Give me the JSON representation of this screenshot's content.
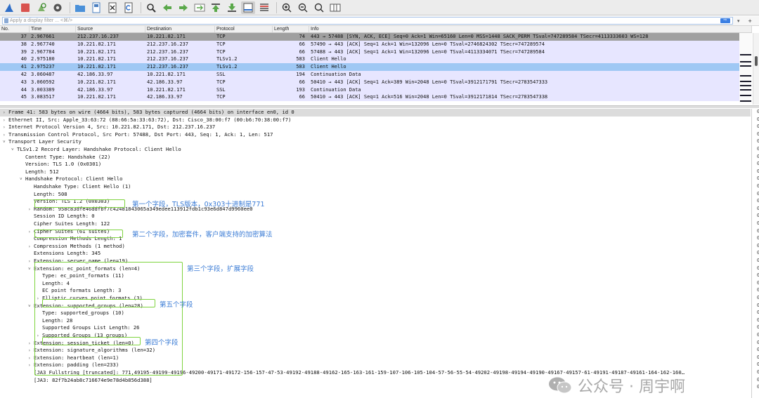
{
  "toolbar": {
    "icons": [
      "shark-fin-icon",
      "stop-icon",
      "restart-icon",
      "options-gear-icon",
      "open-folder-icon",
      "save-file-icon",
      "close-file-icon",
      "reload-icon",
      "find-icon",
      "go-back-icon",
      "go-forward-icon",
      "go-to-packet-icon",
      "first-packet-icon",
      "last-packet-icon",
      "autoscroll-icon",
      "colorize-icon",
      "zoom-in-icon",
      "zoom-out-icon",
      "normal-size-icon",
      "resize-columns-icon"
    ]
  },
  "filter": {
    "placeholder": "Apply a display filter ... <⌘/>",
    "apply_arrow": "⇨",
    "dropdown": "▾",
    "plus": "+"
  },
  "packet_list": {
    "columns": [
      "No.",
      "Time",
      "Source",
      "Destination",
      "Protocol",
      "Length",
      "Info"
    ],
    "rows": [
      {
        "no": "37",
        "time": "2.967661",
        "src": "212.237.16.237",
        "dst": "10.221.82.171",
        "proto": "TCP",
        "len": "74",
        "info": "443 → 57488 [SYN, ACK, ECE] Seq=0 Ack=1 Win=65160 Len=0 MSS=1448 SACK_PERM TSval=747289584 TSecr=4113333603 WS=128",
        "style": "syn"
      },
      {
        "no": "38",
        "time": "2.967740",
        "src": "10.221.82.171",
        "dst": "212.237.16.237",
        "proto": "TCP",
        "len": "66",
        "info": "57490 → 443 [ACK] Seq=1 Ack=1 Win=132096 Len=0 TSval=2746824302 TSecr=747289574",
        "style": "tcp"
      },
      {
        "no": "39",
        "time": "2.967784",
        "src": "10.221.82.171",
        "dst": "212.237.16.237",
        "proto": "TCP",
        "len": "66",
        "info": "57488 → 443 [ACK] Seq=1 Ack=1 Win=132096 Len=0 TSval=4113334071 TSecr=747289584",
        "style": "tcp"
      },
      {
        "no": "40",
        "time": "2.975180",
        "src": "10.221.82.171",
        "dst": "212.237.16.237",
        "proto": "TLSv1.2",
        "len": "583",
        "info": "Client Hello",
        "style": "tcp"
      },
      {
        "no": "41",
        "time": "2.975237",
        "src": "10.221.82.171",
        "dst": "212.237.16.237",
        "proto": "TLSv1.2",
        "len": "583",
        "info": "Client Hello",
        "style": "sel"
      },
      {
        "no": "42",
        "time": "3.060487",
        "src": "42.186.33.97",
        "dst": "10.221.82.171",
        "proto": "SSL",
        "len": "194",
        "info": "Continuation Data",
        "style": "tcp"
      },
      {
        "no": "43",
        "time": "3.060592",
        "src": "10.221.82.171",
        "dst": "42.186.33.97",
        "proto": "TCP",
        "len": "66",
        "info": "50410 → 443 [ACK] Seq=1 Ack=389 Win=2048 Len=0 TSval=3912171791 TSecr=2783547333",
        "style": "tcp"
      },
      {
        "no": "44",
        "time": "3.003389",
        "src": "42.186.33.97",
        "dst": "10.221.82.171",
        "proto": "SSL",
        "len": "193",
        "info": "Continuation Data",
        "style": "tcp"
      },
      {
        "no": "45",
        "time": "3.083517",
        "src": "10.221.82.171",
        "dst": "42.186.33.97",
        "proto": "TCP",
        "len": "66",
        "info": "50410 → 443 [ACK] Seq=1 Ack=516 Win=2048 Len=0 TSval=3912171814 TSecr=2783547338",
        "style": "tcp"
      }
    ]
  },
  "detail": {
    "lines": [
      {
        "text": "Frame 41: 583 bytes on wire (4664 bits), 583 bytes captured (4664 bits) on interface en0, id 0",
        "indent": 0,
        "arrow": "›",
        "hl": true
      },
      {
        "text": "Ethernet II, Src: Apple_33:63:72 (88:66:5a:33:63:72), Dst: Cisco_38:00:f7 (00:b6:70:38:00:f7)",
        "indent": 0,
        "arrow": "›"
      },
      {
        "text": "Internet Protocol Version 4, Src: 10.221.82.171, Dst: 212.237.16.237",
        "indent": 0,
        "arrow": "›"
      },
      {
        "text": "Transmission Control Protocol, Src Port: 57488, Dst Port: 443, Seq: 1, Ack: 1, Len: 517",
        "indent": 0,
        "arrow": "›"
      },
      {
        "text": "Transport Layer Security",
        "indent": 0,
        "arrow": "˅"
      },
      {
        "text": "TLSv1.2 Record Layer: Handshake Protocol: Client Hello",
        "indent": 1,
        "arrow": "˅"
      },
      {
        "text": "Content Type: Handshake (22)",
        "indent": 2,
        "arrow": ""
      },
      {
        "text": "Version: TLS 1.0 (0x0301)",
        "indent": 2,
        "arrow": ""
      },
      {
        "text": "Length: 512",
        "indent": 2,
        "arrow": ""
      },
      {
        "text": "Handshake Protocol: Client Hello",
        "indent": 2,
        "arrow": "˅"
      },
      {
        "text": "Handshake Type: Client Hello (1)",
        "indent": 3,
        "arrow": ""
      },
      {
        "text": "Length: 508",
        "indent": 3,
        "arrow": ""
      },
      {
        "text": "Version: TLS 1.2 (0x0303)",
        "indent": 3,
        "arrow": ""
      },
      {
        "text": "Random: 958c83dfe46ddfbf7c42481843065a349edee113912fdb1c93e6d847d9960ee0",
        "indent": 3,
        "arrow": "›"
      },
      {
        "text": "Session ID Length: 0",
        "indent": 3,
        "arrow": ""
      },
      {
        "text": "Cipher Suites Length: 122",
        "indent": 3,
        "arrow": ""
      },
      {
        "text": "Cipher Suites (61 suites)",
        "indent": 3,
        "arrow": "›"
      },
      {
        "text": "Compression Methods Length: 1",
        "indent": 3,
        "arrow": ""
      },
      {
        "text": "Compression Methods (1 method)",
        "indent": 3,
        "arrow": "›"
      },
      {
        "text": "Extensions Length: 345",
        "indent": 3,
        "arrow": ""
      },
      {
        "text": "Extension: server_name (len=19)",
        "indent": 3,
        "arrow": "›"
      },
      {
        "text": "Extension: ec_point_formats (len=4)",
        "indent": 3,
        "arrow": "˅"
      },
      {
        "text": "Type: ec_point_formats (11)",
        "indent": 4,
        "arrow": ""
      },
      {
        "text": "Length: 4",
        "indent": 4,
        "arrow": ""
      },
      {
        "text": "EC point formats Length: 3",
        "indent": 4,
        "arrow": ""
      },
      {
        "text": "Elliptic curves point formats (3)",
        "indent": 4,
        "arrow": "›"
      },
      {
        "text": "Extension: supported_groups (len=28)",
        "indent": 3,
        "arrow": "˅"
      },
      {
        "text": "Type: supported_groups (10)",
        "indent": 4,
        "arrow": ""
      },
      {
        "text": "Length: 28",
        "indent": 4,
        "arrow": ""
      },
      {
        "text": "Supported Groups List Length: 26",
        "indent": 4,
        "arrow": ""
      },
      {
        "text": "Supported Groups (13 groups)",
        "indent": 4,
        "arrow": "›"
      },
      {
        "text": "Extension: session_ticket (len=0)",
        "indent": 3,
        "arrow": "›"
      },
      {
        "text": "Extension: signature_algorithms (len=32)",
        "indent": 3,
        "arrow": "›"
      },
      {
        "text": "Extension: heartbeat (len=1)",
        "indent": 3,
        "arrow": "›"
      },
      {
        "text": "Extension: padding (len=233)",
        "indent": 3,
        "arrow": "›"
      },
      {
        "text": "[JA3 Fullstring [truncated]: 771,49195-49199-49196-49200-49171-49172-156-157-47-53-49192-49188-49162-165-163-161-159-107-106-105-104-57-56-55-54-49202-49198-49194-49190-49167-49157-61-49191-49187-49161-164-162-160…",
        "indent": 3,
        "arrow": ""
      },
      {
        "text": "[JA3: 82f7b24ab8c716674e9e78d4b856d388]",
        "indent": 3,
        "arrow": ""
      }
    ]
  },
  "annotations": {
    "field1": "第一个字段，TLS版本，0x303十进制是771",
    "field2": "第二个字段，加密套件，客户端支持的加密算法",
    "field3": "第三个字段，扩展字段",
    "field5": "第五个字段",
    "field4": "第四个字段"
  },
  "bytes_column": [
    "0",
    "0",
    "0",
    "0",
    "0",
    "0",
    "0",
    "0",
    "0",
    "0",
    "0",
    "0",
    "0",
    "0",
    "0",
    "0",
    "0",
    "0",
    "0",
    "0",
    "0",
    "0",
    "0",
    "0",
    "0",
    "0",
    "0",
    "0",
    "0",
    "0",
    "0",
    "0",
    "0",
    "0",
    "0",
    "0",
    "0",
    "0"
  ],
  "watermark": {
    "text": "公众号 · 周宇啊",
    "icon": "wechat-icon"
  }
}
